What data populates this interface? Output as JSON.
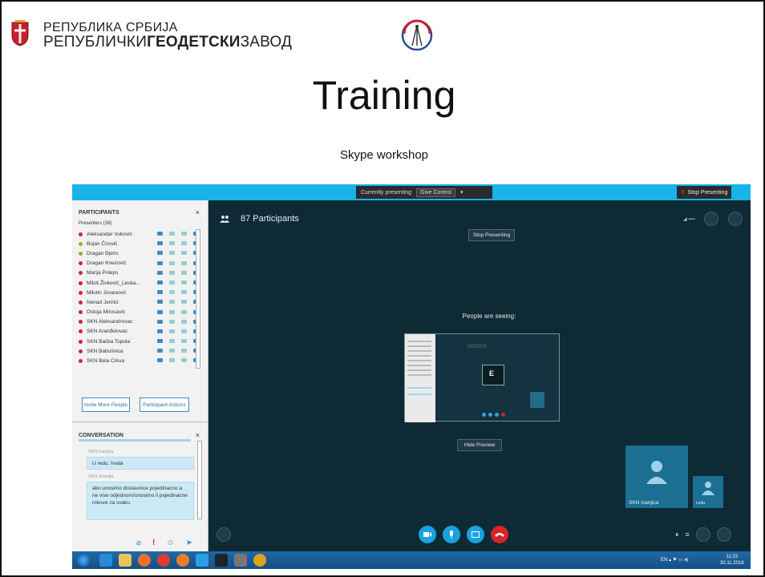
{
  "header": {
    "institution_line1": "РЕПУБЛИКА СРБИЈА",
    "institution_line2_a": "РЕПУБЛИЧКИ",
    "institution_line2_b": "ГЕОДЕТСКИ",
    "institution_line2_c": "ЗАВОД"
  },
  "slide": {
    "title": "Training",
    "subtitle": "Skype workshop"
  },
  "screenshot": {
    "presenting_status": "Currently presenting",
    "give_control": "Give Control",
    "stop_presenting_top": "Stop Presenting",
    "participants_panel": {
      "title": "PARTICIPANTS",
      "section": "Presenters (39)",
      "participants": [
        {
          "name": "Aleksandar Vuković",
          "status": "red"
        },
        {
          "name": "Bojan Čirović",
          "status": "green"
        },
        {
          "name": "Dragan Đjeric",
          "status": "green"
        },
        {
          "name": "Dragan Knezović",
          "status": "red"
        },
        {
          "name": "Marija Poleps",
          "status": "red"
        },
        {
          "name": "Miloš Živković_Leska...",
          "status": "red"
        },
        {
          "name": "Milutin Jovanović",
          "status": "red"
        },
        {
          "name": "Nenad Jerinić",
          "status": "red"
        },
        {
          "name": "Ostoja Mirosavić",
          "status": "red"
        },
        {
          "name": "SKN Aleksandrovac",
          "status": "red"
        },
        {
          "name": "SKN Aranđelovac",
          "status": "red"
        },
        {
          "name": "SKN Bačka Topola",
          "status": "red"
        },
        {
          "name": "SKN Babušnica",
          "status": "red"
        },
        {
          "name": "SKN Bela Crkva",
          "status": "red"
        }
      ],
      "invite_button": "Invite More People",
      "actions_button": "Participant Actions"
    },
    "conversation": {
      "title": "CONVERSATION",
      "messages": [
        {
          "author": "SKN Ivanjica",
          "text": "U redu. hvala"
        },
        {
          "author": "SKN Smedja",
          "text": "ako unosimo dostavnice pojedinacno a ne vise odjednom/unosimo li pojedinacne rokove za svaku"
        }
      ]
    },
    "stage": {
      "participants_count": "87 Participants",
      "stop_presenting": "Stop Presenting",
      "people_seeing": "People are seeing:",
      "hide_preview": "Hide Preview",
      "tile_big_label": "SKN Ivanjica",
      "tile_small_label": "Leda"
    },
    "taskbar": {
      "clock_time": "11:23",
      "clock_date": "30.11.2018",
      "language": "EN"
    }
  }
}
